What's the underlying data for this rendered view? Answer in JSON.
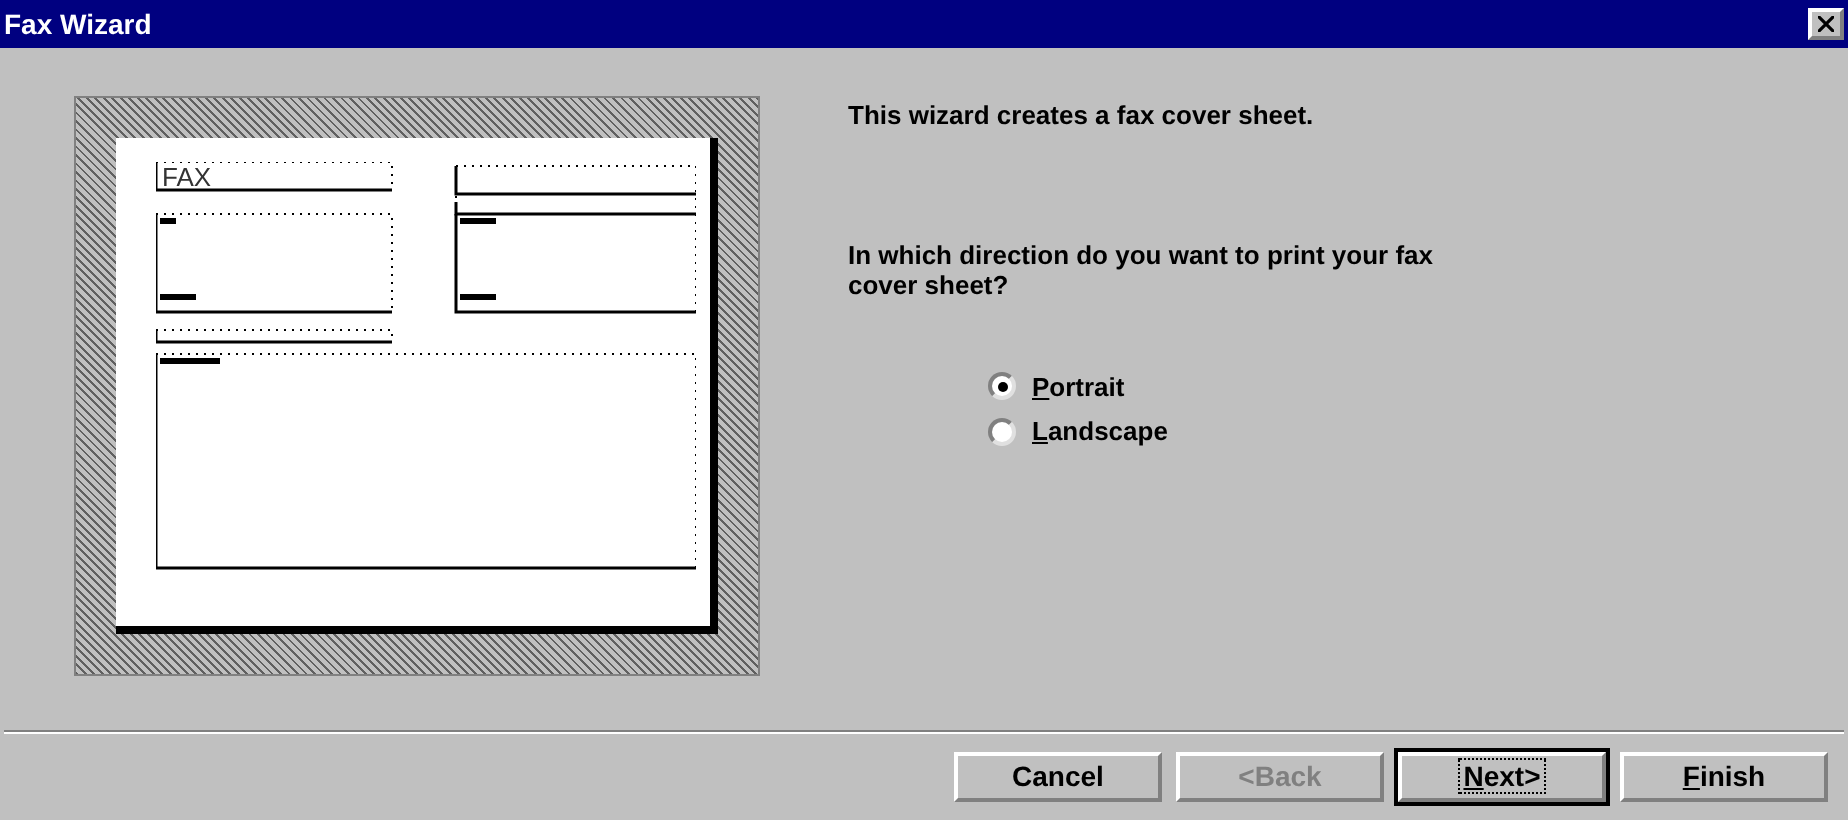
{
  "window": {
    "title": "Fax Wizard"
  },
  "preview": {
    "heading": "FAX"
  },
  "intro": "This wizard creates a fax cover sheet.",
  "question": "In which direction do you want to print your fax cover sheet?",
  "orientation": [
    {
      "mnemonic": "P",
      "rest": "ortrait",
      "selected": true
    },
    {
      "mnemonic": "L",
      "rest": "andscape",
      "selected": false
    }
  ],
  "buttons": [
    {
      "rest": "Cancel",
      "disabled": false,
      "default": false
    },
    {
      "rest": "<Back",
      "disabled": true,
      "default": false
    },
    {
      "mnemonic": "N",
      "rest": "ext>",
      "disabled": false,
      "default": true
    },
    {
      "mnemonic": "F",
      "rest": "inish",
      "disabled": false,
      "default": false
    }
  ]
}
